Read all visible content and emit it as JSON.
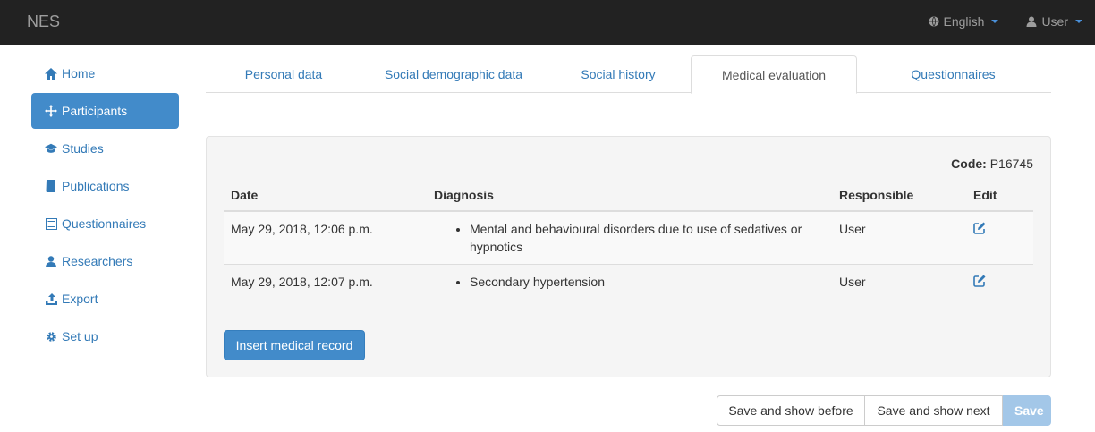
{
  "navbar": {
    "brand": "NES",
    "language": "English",
    "user": "User"
  },
  "sidebar": {
    "items": [
      {
        "label": "Home",
        "icon": "home-icon"
      },
      {
        "label": "Participants",
        "icon": "move-icon",
        "active": true
      },
      {
        "label": "Studies",
        "icon": "education-icon"
      },
      {
        "label": "Publications",
        "icon": "book-icon"
      },
      {
        "label": "Questionnaires",
        "icon": "list-icon"
      },
      {
        "label": "Researchers",
        "icon": "user-icon"
      },
      {
        "label": "Export",
        "icon": "export-icon"
      },
      {
        "label": "Set up",
        "icon": "gear-icon"
      }
    ]
  },
  "tabs": [
    {
      "label": "Personal data"
    },
    {
      "label": "Social demographic data"
    },
    {
      "label": "Social history"
    },
    {
      "label": "Medical evaluation",
      "active": true
    },
    {
      "label": "Questionnaires"
    }
  ],
  "panel": {
    "code_label": "Code:",
    "code_value": "P16745",
    "columns": {
      "date": "Date",
      "diagnosis": "Diagnosis",
      "responsible": "Responsible",
      "edit": "Edit"
    },
    "rows": [
      {
        "date": "May 29, 2018, 12:06 p.m.",
        "diagnosis": "Mental and behavioural disorders due to use of sedatives or hypnotics",
        "responsible": "User"
      },
      {
        "date": "May 29, 2018, 12:07 p.m.",
        "diagnosis": "Secondary hypertension",
        "responsible": "User"
      }
    ],
    "insert_button": "Insert medical record"
  },
  "actions": {
    "save_before": "Save and show before",
    "save_next": "Save and show next",
    "save": "Save"
  },
  "colors": {
    "navbar_bg": "#222222",
    "link": "#337ab7",
    "primary": "#428bca",
    "panel_bg": "#f5f5f5"
  }
}
